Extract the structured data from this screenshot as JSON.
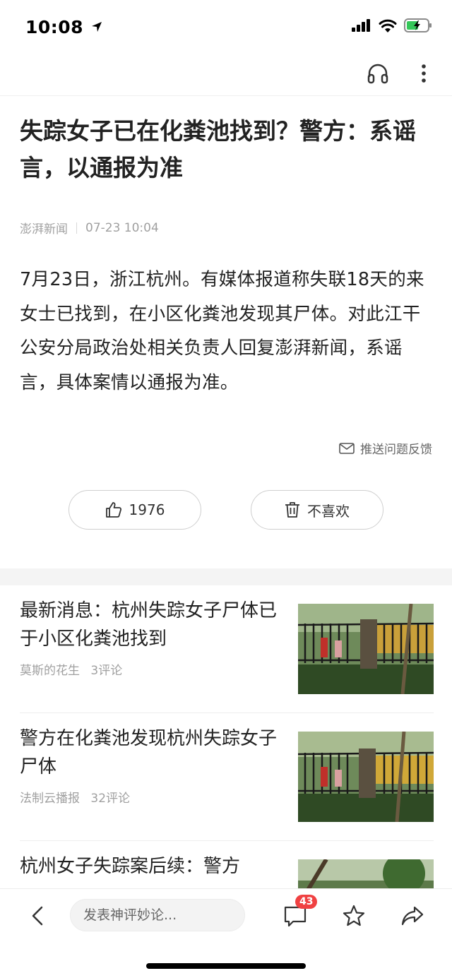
{
  "status_bar": {
    "time": "10:08"
  },
  "article": {
    "title": "失踪女子已在化粪池找到？警方：系谣言，以通报为准",
    "source": "澎湃新闻",
    "datetime": "07-23 10:04",
    "body": "7月23日，浙江杭州。有媒体报道称失联18天的来女士已找到，在小区化粪池发现其尸体。对此江干公安分局政治处相关负责人回复澎湃新闻，系谣言，具体案情以通报为准。",
    "feedback_label": "推送问题反馈",
    "like_count": "1976",
    "dislike_label": "不喜欢"
  },
  "related": [
    {
      "title": "最新消息：杭州失踪女子尸体已于小区化粪池找到",
      "source": "莫斯的花生",
      "comments": "3评论"
    },
    {
      "title": "警方在化粪池发现杭州失踪女子尸体",
      "source": "法制云播报",
      "comments": "32评论"
    },
    {
      "title": "杭州女子失踪案后续：警方",
      "source": "",
      "comments": ""
    }
  ],
  "bottom_bar": {
    "comment_placeholder": "发表神评妙论...",
    "comment_count": "43"
  },
  "colors": {
    "badge": "#f04142",
    "text": "#222222",
    "meta": "#a0a0a0"
  },
  "icons": [
    "location-arrow-icon",
    "signal-icon",
    "wifi-icon",
    "battery-charging-icon",
    "headphones-icon",
    "more-vertical-icon",
    "mail-icon",
    "thumbs-up-icon",
    "trash-icon",
    "back-arrow-icon",
    "comment-icon",
    "star-icon",
    "share-icon"
  ]
}
